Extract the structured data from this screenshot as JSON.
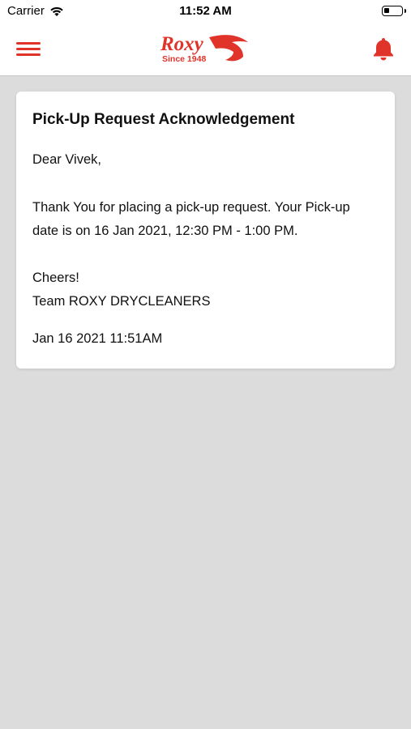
{
  "status_bar": {
    "carrier": "Carrier",
    "time": "11:52 AM",
    "wifi_icon": "wifi-icon",
    "battery_icon": "battery-icon"
  },
  "header": {
    "menu_icon": "hamburger-menu-icon",
    "logo_text": "Roxy",
    "logo_tagline": "Since 1948",
    "bell_icon": "bell-icon",
    "accent_color": "#e0332a"
  },
  "notification": {
    "title": "Pick-Up Request Acknowledgement",
    "greeting": "Dear Vivek,",
    "body_line1": "Thank You for placing a pick-up request. Your Pick-up",
    "body_line2": "date is on 16 Jan 2021, 12:30 PM - 1:00 PM.",
    "signoff_line1": "Cheers!",
    "signoff_line2": "Team ROXY DRYCLEANERS",
    "timestamp": "Jan 16 2021 11:51AM"
  }
}
